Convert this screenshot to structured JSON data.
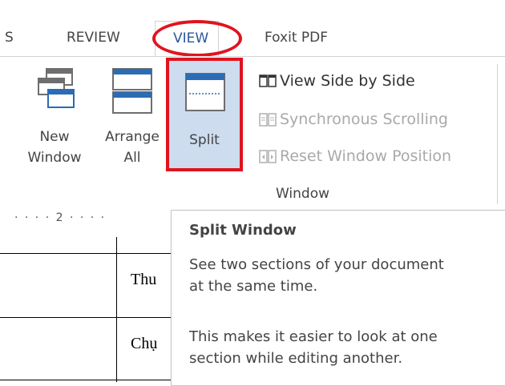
{
  "tabs": {
    "partial_left": "S",
    "review": "REVIEW",
    "view": "VIEW",
    "foxit": "Foxit PDF"
  },
  "ribbon": {
    "new_window": {
      "line1": "New",
      "line2": "Window"
    },
    "arrange_all": {
      "line1": "Arrange",
      "line2": "All"
    },
    "split": "Split",
    "view_side_by_side": "View Side by Side",
    "synchronous_scrolling": "Synchronous Scrolling",
    "reset_window_position": "Reset Window Position",
    "group_label": "Window"
  },
  "ruler": {
    "text": "· · · · 2 · · · ·"
  },
  "document": {
    "cell1": "Thu",
    "cell2": "Chụ"
  },
  "tooltip": {
    "title": "Split Window",
    "line1": "See two sections of your document",
    "line2": "at the same time.",
    "line3": "This makes it easier to look at one",
    "line4": "section while editing another."
  },
  "colors": {
    "accent": "#2b579a",
    "highlight_red": "#e0141e",
    "split_selected_bg": "#cddcef",
    "disabled_text": "#a9a9a9"
  },
  "icons": {
    "new_window": "new-window-icon",
    "arrange_all": "arrange-all-icon",
    "split": "split-icon",
    "view_side_by_side": "view-side-by-side-icon",
    "synchronous_scrolling": "synchronous-scrolling-icon",
    "reset_window_position": "reset-window-position-icon"
  }
}
